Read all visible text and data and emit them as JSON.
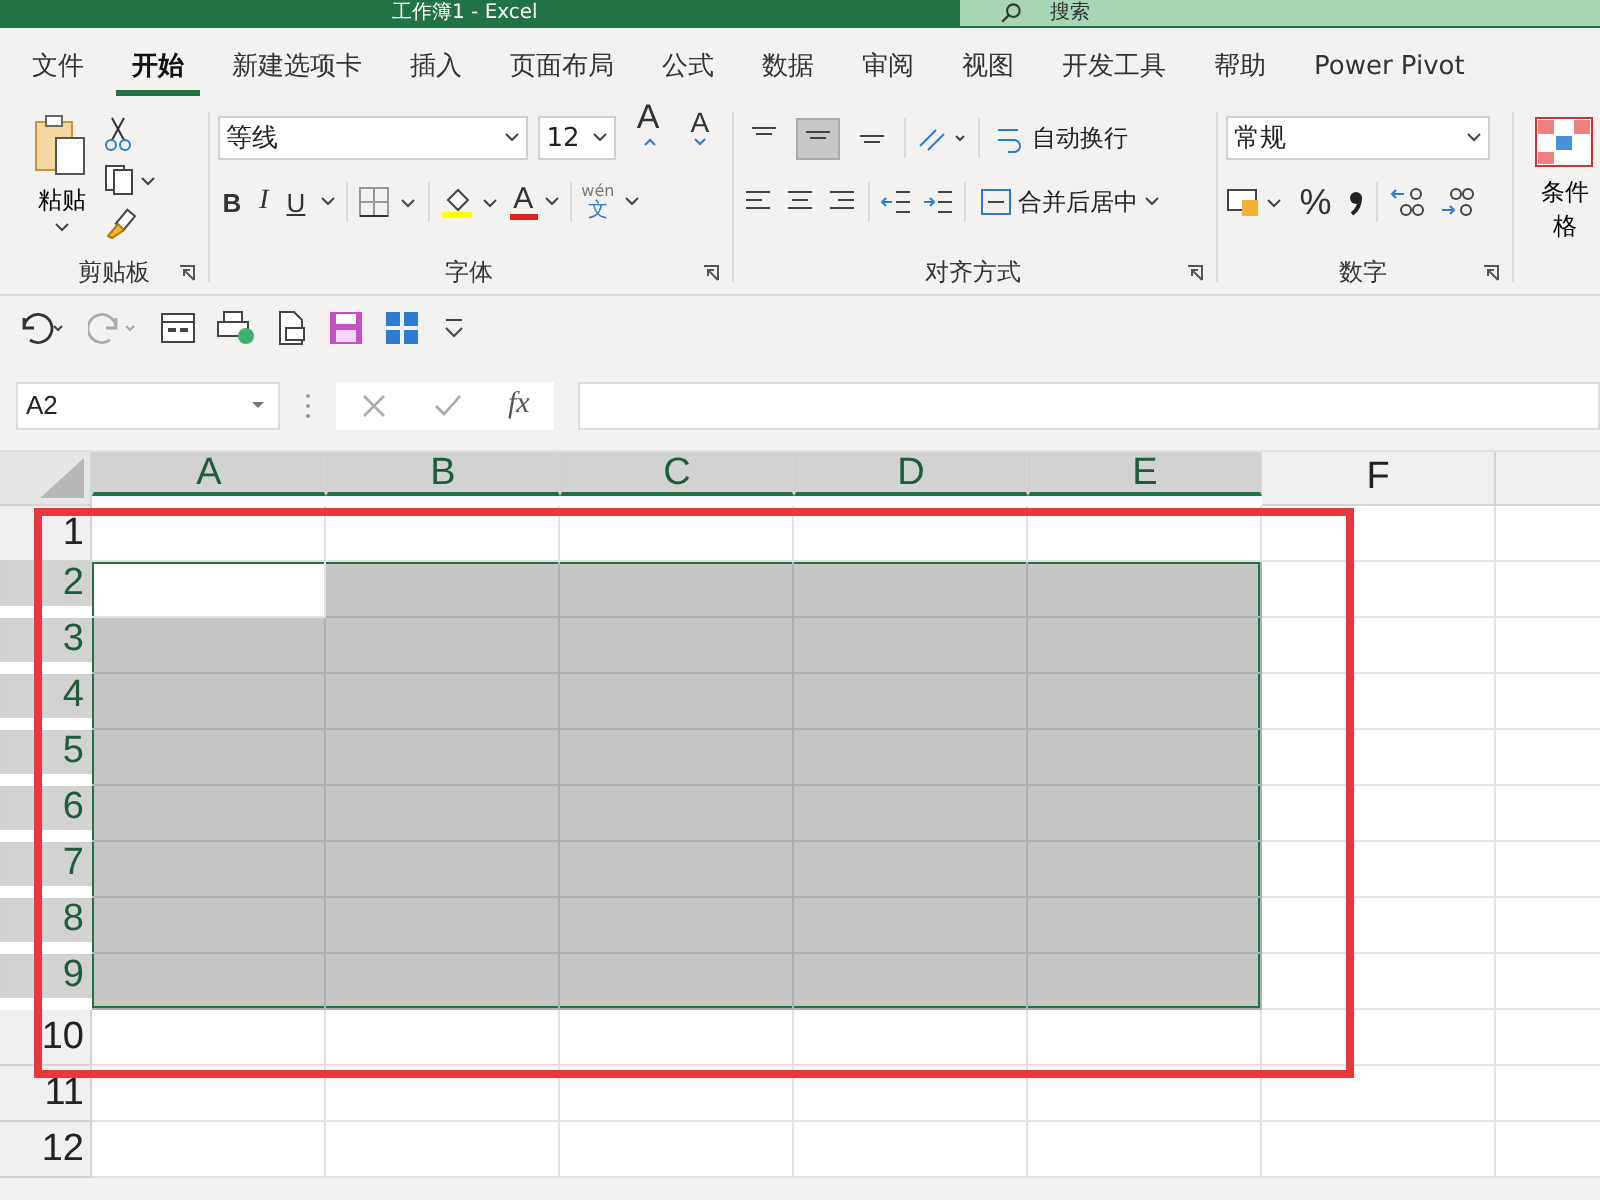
{
  "title_bar": {
    "title": "工作簿1  -  Excel",
    "search_placeholder": "搜索"
  },
  "tabs": [
    {
      "label": "文件",
      "selected": false
    },
    {
      "label": "开始",
      "selected": true
    },
    {
      "label": "新建选项卡",
      "selected": false
    },
    {
      "label": "插入",
      "selected": false
    },
    {
      "label": "页面布局",
      "selected": false
    },
    {
      "label": "公式",
      "selected": false
    },
    {
      "label": "数据",
      "selected": false
    },
    {
      "label": "审阅",
      "selected": false
    },
    {
      "label": "视图",
      "selected": false
    },
    {
      "label": "开发工具",
      "selected": false
    },
    {
      "label": "帮助",
      "selected": false
    },
    {
      "label": "Power Pivot",
      "selected": false
    }
  ],
  "ribbon": {
    "clipboard": {
      "paste_label": "粘贴",
      "group_label": "剪贴板"
    },
    "font": {
      "font_name": "等线",
      "font_size": "12",
      "grow_glyph": "A",
      "shrink_glyph": "A",
      "bold": "B",
      "italic": "I",
      "underline": "U",
      "font_color_glyph": "A",
      "phonetic_top": "wén",
      "phonetic_bottom": "文",
      "group_label": "字体"
    },
    "alignment": {
      "vertical_buttons": [
        {
          "selected": false
        },
        {
          "selected": true
        },
        {
          "selected": false
        }
      ],
      "wrap_text": "自动换行",
      "merge_center": "合并后居中",
      "group_label": "对齐方式"
    },
    "number": {
      "format": "常规",
      "percent": "%",
      "group_label": "数字"
    },
    "styles": {
      "conditional_format": "条件格"
    }
  },
  "name_box": {
    "value": "A2"
  },
  "formula_bar": {
    "fx": "fx"
  },
  "grid": {
    "active_cell_highlight": true,
    "columns": [
      {
        "label": "A",
        "selected": true
      },
      {
        "label": "B",
        "selected": true
      },
      {
        "label": "C",
        "selected": true
      },
      {
        "label": "D",
        "selected": true
      },
      {
        "label": "E",
        "selected": true
      },
      {
        "label": "F",
        "selected": false
      },
      {
        "selected": false
      }
    ],
    "rows": [
      {
        "label": "1",
        "selected": false
      },
      {
        "label": "2",
        "selected": true
      },
      {
        "label": "3",
        "selected": true
      },
      {
        "label": "4",
        "selected": true
      },
      {
        "label": "5",
        "selected": true
      },
      {
        "label": "6",
        "selected": true
      },
      {
        "label": "7",
        "selected": true
      },
      {
        "label": "8",
        "selected": true
      },
      {
        "label": "9",
        "selected": true
      },
      {
        "label": "10",
        "selected": false
      },
      {
        "label": "11",
        "selected": false
      },
      {
        "label": "12",
        "selected": false
      }
    ]
  },
  "highlight_frame": true
}
